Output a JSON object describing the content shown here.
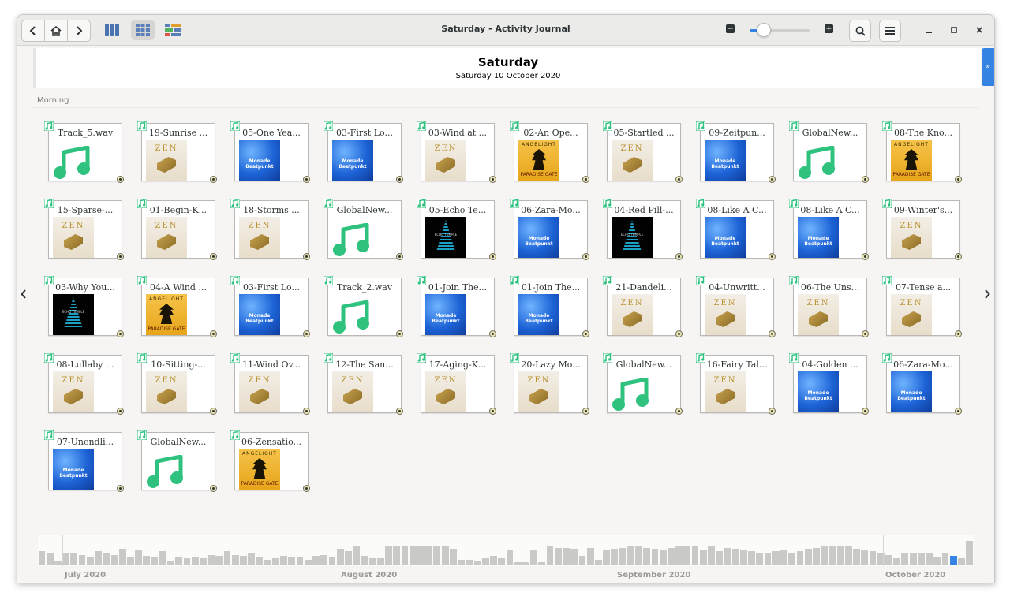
{
  "window": {
    "title": "Saturday - Activity Journal"
  },
  "header": {
    "title": "Saturday",
    "date": "Saturday 10 October 2020"
  },
  "section": {
    "label": "Morning"
  },
  "colors": {
    "accent": "#3584e4",
    "music_badge": "#2ec27e"
  },
  "zoom": {
    "level": 0.22
  },
  "tiles": [
    {
      "label": "Track_5.wav",
      "thumb": "note"
    },
    {
      "label": "19-Sunrise ...",
      "thumb": "zen"
    },
    {
      "label": "05-One Yea...",
      "thumb": "blue"
    },
    {
      "label": "03-First Lo...",
      "thumb": "blue"
    },
    {
      "label": "03-Wind at ...",
      "thumb": "zen"
    },
    {
      "label": "02-An Ope...",
      "thumb": "gold"
    },
    {
      "label": "05-Startled ...",
      "thumb": "zen"
    },
    {
      "label": "09-Zeitpun...",
      "thumb": "blue"
    },
    {
      "label": "GlobalNew...",
      "thumb": "note"
    },
    {
      "label": "08-The Kno...",
      "thumb": "gold"
    },
    {
      "label": "15-Sparse-...",
      "thumb": "zen"
    },
    {
      "label": "01-Begin-K...",
      "thumb": "zen"
    },
    {
      "label": "18-Storms ...",
      "thumb": "zen"
    },
    {
      "label": "GlobalNew...",
      "thumb": "note"
    },
    {
      "label": "05-Echo Te...",
      "thumb": "dark"
    },
    {
      "label": "06-Zara-Mo...",
      "thumb": "blue"
    },
    {
      "label": "04-Red Pill-...",
      "thumb": "dark"
    },
    {
      "label": "08-Like A C...",
      "thumb": "blue"
    },
    {
      "label": "08-Like A C...",
      "thumb": "blue"
    },
    {
      "label": "09-Winter's...",
      "thumb": "zen"
    },
    {
      "label": "03-Why You...",
      "thumb": "dark"
    },
    {
      "label": "04-A Wind ...",
      "thumb": "gold"
    },
    {
      "label": "03-First Lo...",
      "thumb": "blue"
    },
    {
      "label": "Track_2.wav",
      "thumb": "note"
    },
    {
      "label": "01-Join The...",
      "thumb": "blue"
    },
    {
      "label": "01-Join The...",
      "thumb": "blue"
    },
    {
      "label": "21-Dandeli...",
      "thumb": "zen"
    },
    {
      "label": "04-Unwritt...",
      "thumb": "zen"
    },
    {
      "label": "06-The Uns...",
      "thumb": "zen"
    },
    {
      "label": "07-Tense a...",
      "thumb": "zen"
    },
    {
      "label": "08-Lullaby ...",
      "thumb": "zen"
    },
    {
      "label": "10-Sitting-...",
      "thumb": "zen"
    },
    {
      "label": "11-Wind Ov...",
      "thumb": "zen"
    },
    {
      "label": "12-The San...",
      "thumb": "zen"
    },
    {
      "label": "17-Aging-K...",
      "thumb": "zen"
    },
    {
      "label": "20-Lazy Mo...",
      "thumb": "zen"
    },
    {
      "label": "GlobalNew...",
      "thumb": "note"
    },
    {
      "label": "16-Fairy Tal...",
      "thumb": "zen"
    },
    {
      "label": "04-Golden ...",
      "thumb": "blue"
    },
    {
      "label": "06-Zara-Mo...",
      "thumb": "blue"
    },
    {
      "label": "07-Unendli...",
      "thumb": "blue"
    },
    {
      "label": "GlobalNew...",
      "thumb": "note"
    },
    {
      "label": "06-Zensatio...",
      "thumb": "gold"
    }
  ],
  "covers": {
    "zen_text": "ZEN",
    "blue_text": "Monade Beatpunkt",
    "gold_top": "ANGELIGHT",
    "gold_bottom": "PARADISE GATE",
    "dark_text": "ECHO TEMPLE"
  },
  "timeline": {
    "months": [
      "July 2020",
      "August 2020",
      "September 2020",
      "October 2020"
    ],
    "activity": [
      0.55,
      0.45,
      0.15,
      0.5,
      0.45,
      0.4,
      0.3,
      0.55,
      0.5,
      0.4,
      0.65,
      0.3,
      0.6,
      0.35,
      0.3,
      0.55,
      0.15,
      0.3,
      0.25,
      0.3,
      0.25,
      0.4,
      0.35,
      0.55,
      0.4,
      0.35,
      0.45,
      0.3,
      0.2,
      0.25,
      0.35,
      0.3,
      0.3,
      0.2,
      0.35,
      0.4,
      0.3,
      0.65,
      0.55,
      0.75,
      0.35,
      0.25,
      0.25,
      0.75,
      0.75,
      0.75,
      0.75,
      0.75,
      0.75,
      0.75,
      0.75,
      0.65,
      0.2,
      0.2,
      0.15,
      0.25,
      0.35,
      0.25,
      0.6,
      0.1,
      0.1,
      0.6,
      0.1,
      0.75,
      0.7,
      0.7,
      0.65,
      0.35,
      0.7,
      0.2,
      0.6,
      0.65,
      0.7,
      0.75,
      0.75,
      0.7,
      0.65,
      0.6,
      0.7,
      0.75,
      0.75,
      0.75,
      0.6,
      0.75,
      0.55,
      0.7,
      0.65,
      0.6,
      0.55,
      0.5,
      0.5,
      0.55,
      0.6,
      0.5,
      0.55,
      0.65,
      0.7,
      0.75,
      0.75,
      0.75,
      0.75,
      0.65,
      0.6,
      0.55,
      0.45,
      0.4,
      0.25,
      0.5,
      0.45,
      0.45,
      0.45,
      0.3,
      0.45,
      0.35,
      0.25,
      1.0
    ],
    "selected_index": 113
  }
}
